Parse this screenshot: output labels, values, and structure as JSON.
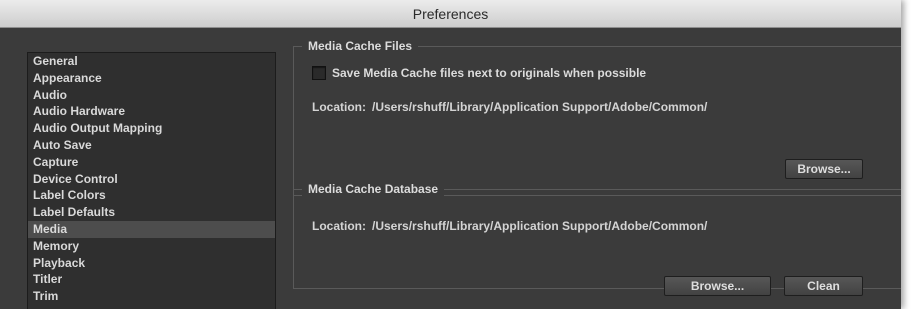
{
  "window": {
    "title": "Preferences"
  },
  "sidebar": {
    "items": [
      {
        "label": "General",
        "selected": false
      },
      {
        "label": "Appearance",
        "selected": false
      },
      {
        "label": "Audio",
        "selected": false
      },
      {
        "label": "Audio Hardware",
        "selected": false
      },
      {
        "label": "Audio Output Mapping",
        "selected": false
      },
      {
        "label": "Auto Save",
        "selected": false
      },
      {
        "label": "Capture",
        "selected": false
      },
      {
        "label": "Device Control",
        "selected": false
      },
      {
        "label": "Label Colors",
        "selected": false
      },
      {
        "label": "Label Defaults",
        "selected": false
      },
      {
        "label": "Media",
        "selected": true
      },
      {
        "label": "Memory",
        "selected": false
      },
      {
        "label": "Playback",
        "selected": false
      },
      {
        "label": "Titler",
        "selected": false
      },
      {
        "label": "Trim",
        "selected": false
      }
    ]
  },
  "media_cache_files": {
    "legend": "Media Cache Files",
    "checkbox_label": "Save Media Cache files next to originals when possible",
    "checkbox_checked": false,
    "location_label": "Location:",
    "location_value": "/Users/rshuff/Library/Application Support/Adobe/Common/",
    "browse_label": "Browse..."
  },
  "media_cache_database": {
    "legend": "Media Cache Database",
    "location_label": "Location:",
    "location_value": "/Users/rshuff/Library/Application Support/Adobe/Common/",
    "browse_label": "Browse...",
    "clean_label": "Clean"
  },
  "colors": {
    "panel_bg": "#3b3b3b",
    "list_bg": "#2f2f2f",
    "selected_row": "#4d4d4d",
    "text": "#d9d9d9"
  }
}
